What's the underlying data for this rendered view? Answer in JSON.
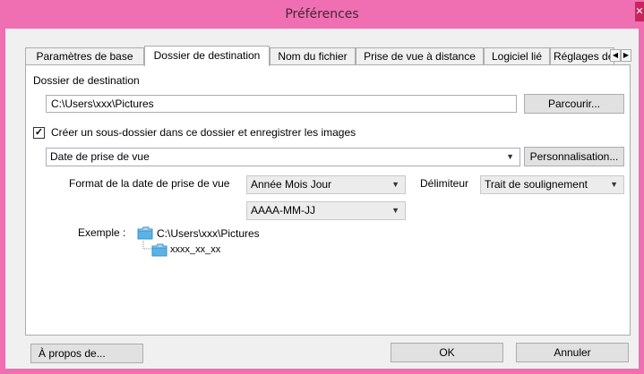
{
  "window": {
    "title": "Préférences"
  },
  "tabs": [
    {
      "label": "Paramètres de base",
      "active": false
    },
    {
      "label": "Dossier de destination",
      "active": true
    },
    {
      "label": "Nom du fichier",
      "active": false
    },
    {
      "label": "Prise de vue à distance",
      "active": false
    },
    {
      "label": "Logiciel lié",
      "active": false
    },
    {
      "label": "Réglages de",
      "active": false
    }
  ],
  "destination": {
    "label": "Dossier de destination",
    "path": "C:\\Users\\xxx\\Pictures",
    "browse_label": "Parcourir..."
  },
  "subfolder": {
    "checkbox_label": "Créer un sous-dossier dans ce dossier et enregistrer les images",
    "checked": true,
    "mode_value": "Date de prise de vue",
    "custom_label": "Personnalisation..."
  },
  "date_format": {
    "label": "Format de la date de prise de vue",
    "order_value": "Année Mois Jour",
    "pattern_value": "AAAA-MM-JJ",
    "delimiter_label": "Délimiteur",
    "delimiter_value": "Trait de soulignement"
  },
  "example": {
    "label": "Exemple :",
    "root": "C:\\Users\\xxx\\Pictures",
    "sub": "xxxx_xx_xx"
  },
  "footer": {
    "about_label": "À propos de...",
    "ok_label": "OK",
    "cancel_label": "Annuler"
  },
  "colors": {
    "titlebar": "#ef6fb2",
    "folder": "#5ab3e6"
  },
  "icons": [
    "close-icon",
    "checkmark-icon",
    "chevron-down-icon",
    "folder-icon",
    "arrow-left-icon",
    "arrow-right-icon"
  ]
}
